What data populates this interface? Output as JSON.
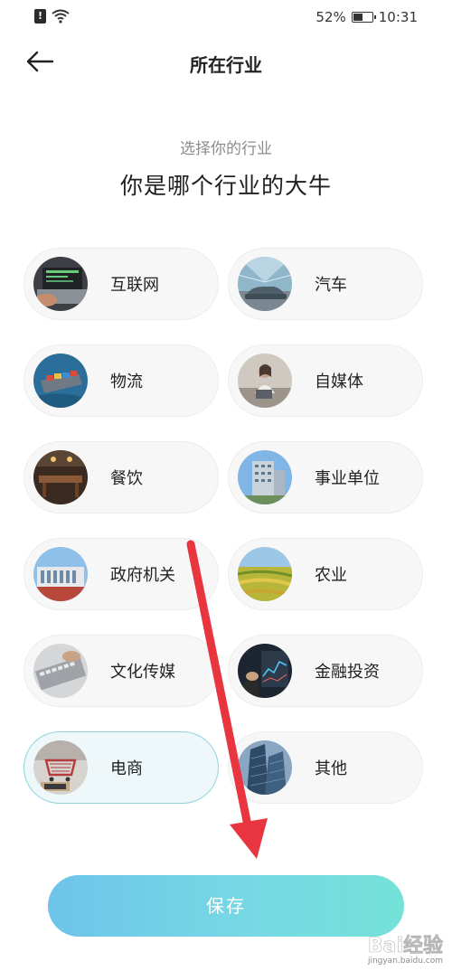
{
  "status_bar": {
    "battery_percent": "52%",
    "battery_level": 0.52,
    "time": "10:31",
    "icons": [
      "alert-icon",
      "wifi-icon",
      "battery-icon"
    ]
  },
  "header": {
    "title": "所在行业",
    "back_icon": "arrow-left-icon"
  },
  "subtitle": "选择你的行业",
  "headline": "你是哪个行业的大牛",
  "industries": [
    {
      "label": "互联网",
      "image": "laptop-photo",
      "selected": false
    },
    {
      "label": "汽车",
      "image": "car-photo",
      "selected": false
    },
    {
      "label": "物流",
      "image": "cargo-ship-photo",
      "selected": false
    },
    {
      "label": "自媒体",
      "image": "woman-laptop-photo",
      "selected": false
    },
    {
      "label": "餐饮",
      "image": "restaurant-photo",
      "selected": false
    },
    {
      "label": "事业单位",
      "image": "office-building-photo",
      "selected": false
    },
    {
      "label": "政府机关",
      "image": "government-building-photo",
      "selected": false
    },
    {
      "label": "农业",
      "image": "farmland-photo",
      "selected": false
    },
    {
      "label": "文化传媒",
      "image": "keyboard-photo",
      "selected": false
    },
    {
      "label": "金融投资",
      "image": "trading-screen-photo",
      "selected": false
    },
    {
      "label": "电商",
      "image": "shopping-cart-photo",
      "selected": true
    },
    {
      "label": "其他",
      "image": "skyscraper-photo",
      "selected": false
    }
  ],
  "save_button": {
    "label": "保存"
  },
  "colors": {
    "save_gradient_start": "#6ec4ea",
    "save_gradient_end": "#74e2d8",
    "selected_border": "#8fd2de",
    "annotation_arrow": "#e8353f"
  },
  "watermark": {
    "logo": "Bai经验",
    "url": "jingyan.baidu.com"
  }
}
